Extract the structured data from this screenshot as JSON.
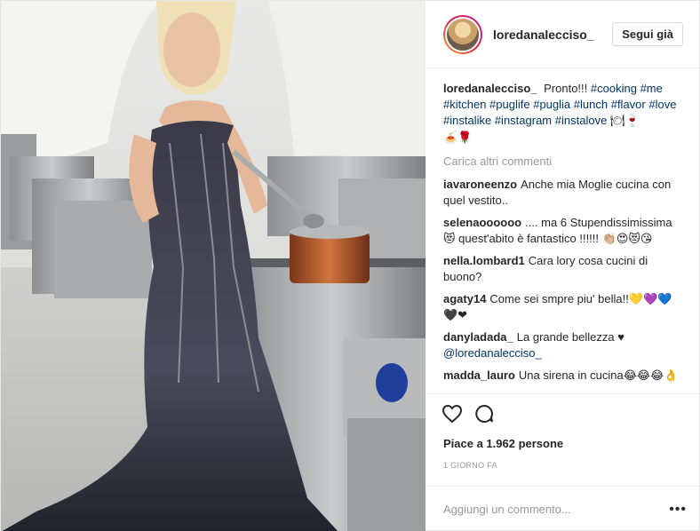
{
  "post": {
    "username": "loredanalecciso_",
    "follow_label": "Segui già",
    "caption": {
      "user": "loredanalecciso_",
      "text": "Pronto!!!",
      "hashtags": [
        "#cooking",
        "#me",
        "#kitchen",
        "#puglife",
        "#puglia",
        "#lunch",
        "#flavor",
        "#love",
        "#instalike",
        "#instagram",
        "#instalove"
      ],
      "emoji_tail": "🍽🍷",
      "emoji_line": "🍝🌹"
    },
    "load_more": "Carica altri commenti",
    "comments": [
      {
        "user": "iavaroneenzo",
        "text": "Anche mia Moglie cucina con quel vestito.."
      },
      {
        "user": "selenaoooooo",
        "text": ".... ma 6 Stupendissimissima 😻 quest'abito è fantastico !!!!!! 👏🏼😍😻😘"
      },
      {
        "user": "nella.lombard1",
        "text": "Cara lory cosa cucini di buono?"
      },
      {
        "user": "agaty14",
        "text": "Come sei smpre piu' bella!!💛💜💙🖤❤"
      },
      {
        "user": "danyladada_",
        "text": "La grande bellezza ♥",
        "mention": "@loredanalecciso_"
      },
      {
        "user": "madda_lauro",
        "text": "Una sirena in cucina😂😂😂👌"
      }
    ],
    "likes": "Piace a 1.962 persone",
    "time": "1 GIORNO FA",
    "add_comment_placeholder": "Aggiungi un commento...",
    "more_options": "•••"
  },
  "icons": [
    "heart-icon",
    "comment-icon",
    "more-options-icon"
  ]
}
